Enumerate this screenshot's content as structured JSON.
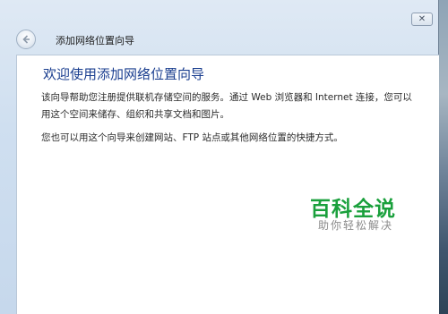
{
  "window": {
    "title": "添加网络位置向导",
    "close_icon": "close-icon",
    "back_icon": "back-arrow-icon"
  },
  "content": {
    "heading": "欢迎使用添加网络位置向导",
    "paragraph1": "该向导帮助您注册提供联机存储空间的服务。通过 Web 浏览器和 Internet 连接，您可以用这个空间来储存、组织和共享文档和图片。",
    "paragraph2": "您也可以用这个向导来创建网站、FTP 站点或其他网络位置的快捷方式。"
  },
  "watermark": {
    "title": "百科全说",
    "subtitle": "助你轻松解决"
  },
  "colors": {
    "heading": "#1a3e8f",
    "watermark_green": "#1aa03c"
  }
}
